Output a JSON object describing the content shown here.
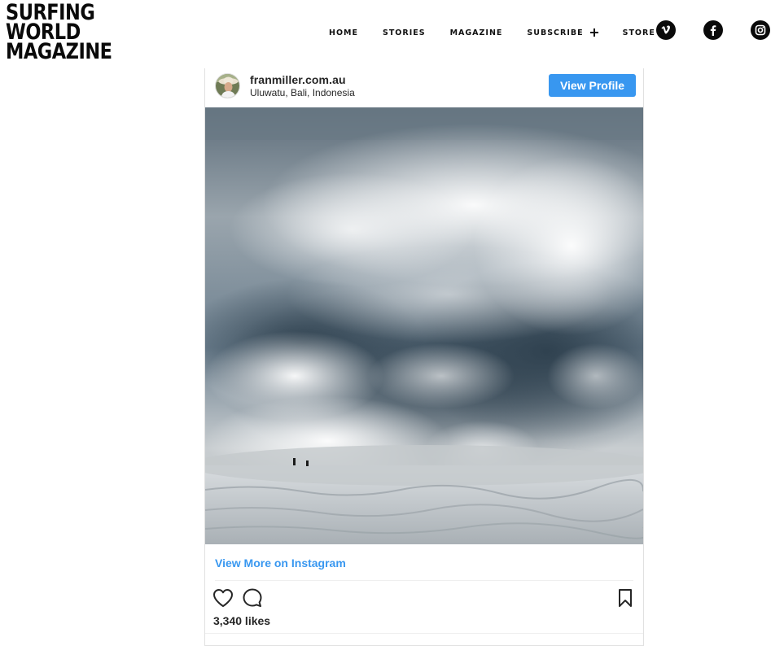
{
  "site": {
    "logo_lines": [
      "SURFING",
      "WORLD",
      "MAGAZINE"
    ]
  },
  "nav": {
    "home": "HOME",
    "stories": "STORIES",
    "magazine": "MAGAZINE",
    "subscribe": "SUBSCRIBE",
    "store": "STORE"
  },
  "social": {
    "icons": [
      "vimeo-icon",
      "facebook-icon",
      "instagram-icon"
    ]
  },
  "post": {
    "username": "franmiller.com.au",
    "location": "Uluwatu, Bali, Indonesia",
    "view_profile_label": "View Profile",
    "view_more_label": "View More on Instagram",
    "likes": "3,340 likes"
  },
  "colors": {
    "accent": "#3897f0",
    "text": "#262626",
    "logo": "#0a0a0a"
  }
}
